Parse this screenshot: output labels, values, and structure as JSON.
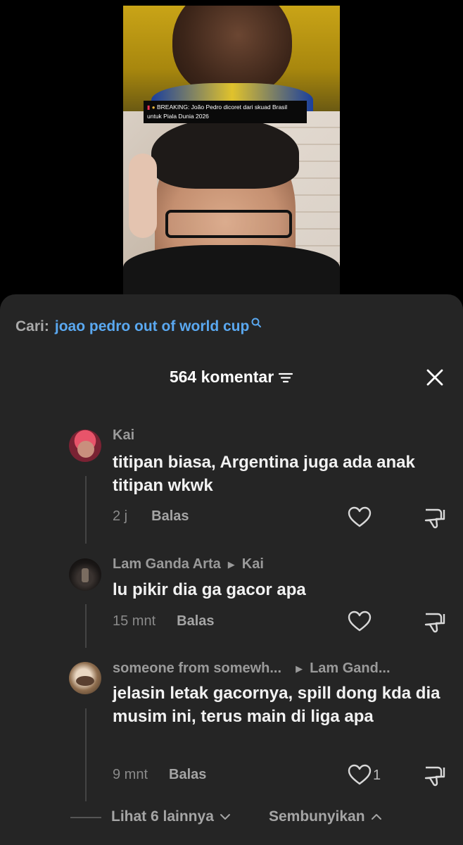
{
  "video": {
    "caption": "BREAKING: João Pedro dicoret dari skuad Brasil untuk Piala Dunia 2026",
    "caption_icons": [
      "pin-icon",
      "chip-face-emoji-icon"
    ]
  },
  "search": {
    "label": "Cari:",
    "query": "joao pedro out of world cup",
    "icon": "search-icon"
  },
  "header": {
    "count_label": "564 komentar",
    "filter_icon": "filter-icon",
    "close_icon": "close-icon"
  },
  "comments": [
    {
      "username": "Kai",
      "reply_to": "",
      "text": "titipan biasa, Argentina juga ada anak titipan wkwk",
      "time": "2 j",
      "reply_label": "Balas",
      "likes": ""
    },
    {
      "username": "Lam Ganda Arta",
      "reply_to": "Kai",
      "text": "lu pikir dia ga gacor apa",
      "time": "15 mnt",
      "reply_label": "Balas",
      "likes": ""
    },
    {
      "username": "someone from somewh...",
      "reply_to": "Lam Gand...",
      "text": "jelasin letak gacornya, spill dong kda dia musim ini, terus main di liga apa",
      "time": "9 mnt",
      "reply_label": "Balas",
      "likes": "1"
    }
  ],
  "footer": {
    "more_label": "Lihat 6 lainnya",
    "hide_label": "Sembunyikan"
  },
  "colors": {
    "sheet_bg": "#252525",
    "query_blue": "#5aa8f0",
    "text_primary": "#f2f2f2",
    "text_secondary": "#9a9a9a"
  }
}
